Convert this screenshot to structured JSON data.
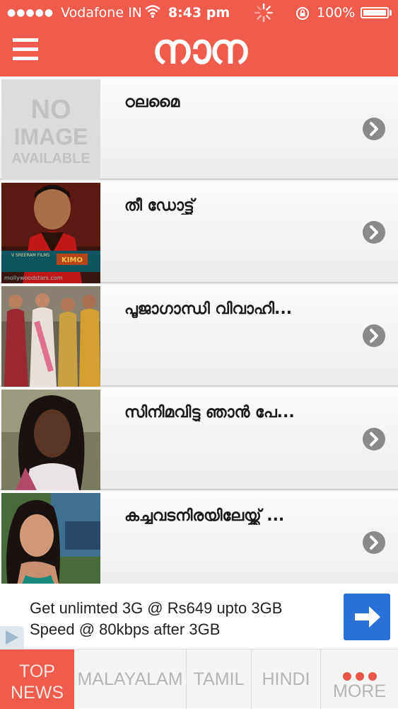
{
  "status_bar": {
    "signal_dots": "●●●●●",
    "carrier": "Vodafone IN",
    "time": "8:43 pm",
    "battery": "100%"
  },
  "header": {
    "logo": "നാന",
    "menu_icon": "hamburger-menu-icon",
    "background": "#ef5b4d"
  },
  "list": {
    "items": [
      {
        "title": "ഠലമൈ",
        "thumbnail": "no-image-available",
        "thumbnail_text": [
          "NO",
          "IMAGE",
          "AVAILABLE"
        ]
      },
      {
        "title": "തീ ഡോട്ട്സ്",
        "thumbnail": "actor-photo",
        "thumbnail_caption": "mollywoodstars.com"
      },
      {
        "title": "പൂജാഗാന്ധി വിവാഹി...",
        "thumbnail": "group-photo"
      },
      {
        "title": "സിനിമവിട്ടു ഞാൻ പേ...",
        "thumbnail": "actress-portrait"
      },
      {
        "title": "കച്ചവടനിരയിലേയ്ക്ക് ...",
        "thumbnail": "actress-photo"
      }
    ],
    "row_icon": "chevron-right-circle-icon"
  },
  "ad": {
    "line1": "Get unlimted 3G @ Rs649 upto 3GB",
    "line2": "Speed @ 80kbps after 3GB",
    "button_icon": "arrow-right-icon",
    "button_color": "#2a72d8"
  },
  "tabs": [
    {
      "line1": "TOP",
      "line2": "NEWS",
      "active": true
    },
    {
      "label": "MALAYALAM"
    },
    {
      "label": "TAMIL"
    },
    {
      "label": "HINDI"
    },
    {
      "label": "MORE"
    }
  ]
}
